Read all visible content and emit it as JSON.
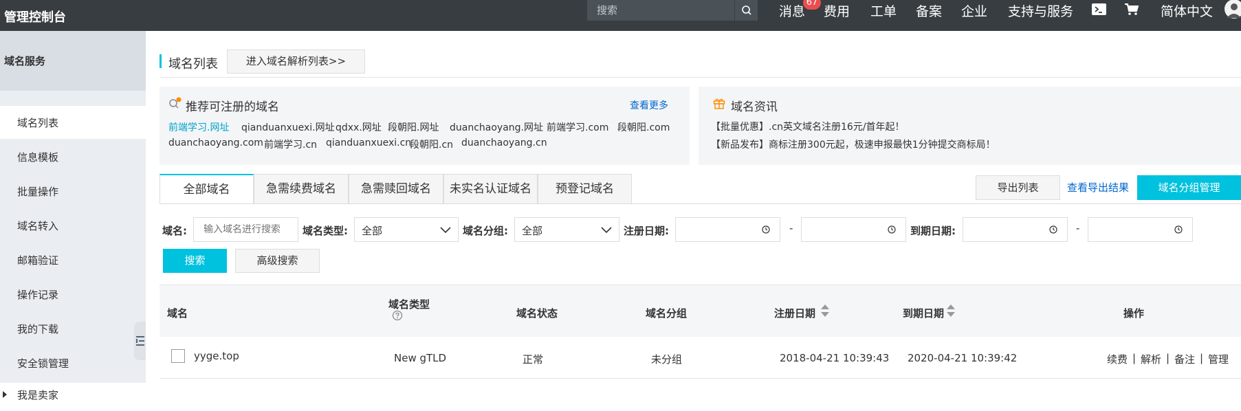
{
  "topbar": {
    "title": "管理控制台",
    "search_placeholder": "搜索",
    "nav": [
      "消息",
      "费用",
      "工单",
      "备案",
      "企业",
      "支持与服务",
      "简体中文"
    ],
    "message_badge": "67"
  },
  "sidebar": {
    "header": "域名服务",
    "items": [
      "域名列表",
      "信息模板",
      "批量操作",
      "域名转入",
      "邮箱验证",
      "操作记录",
      "我的下载",
      "安全锁管理",
      "我是卖家"
    ],
    "active_index": 0
  },
  "page": {
    "title": "域名列表",
    "dns_button": "进入域名解析列表>>"
  },
  "recommend": {
    "title": "推荐可注册的域名",
    "more": "查看更多",
    "domains": [
      "前端学习.网址",
      "qianduanxuexi.网址",
      "qdxx.网址",
      "段朝阳.网址",
      "duanchaoyang.网址",
      "前端学习.com",
      "段朝阳.com",
      "duanchaoyang.com",
      "前端学习.cn",
      "qianduanxuexi.cn",
      "段朝阳.cn",
      "duanchaoyang.cn"
    ]
  },
  "news": {
    "title": "域名资讯",
    "items": [
      "【批量优惠】.cn英文域名注册16元/首年起！",
      "【新品发布】商标注册300元起，极速申报最快1分钟提交商标局！"
    ]
  },
  "tabs": [
    "全部域名",
    "急需续费域名",
    "急需赎回域名",
    "未实名认证域名",
    "预登记域名"
  ],
  "actions": {
    "export": "导出列表",
    "view_export": "查看导出结果",
    "group_manage": "域名分组管理"
  },
  "filters": {
    "domain_label": "域名:",
    "domain_placeholder": "输入域名进行搜索",
    "type_label": "域名类型:",
    "type_value": "全部",
    "group_label": "域名分组:",
    "group_value": "全部",
    "reg_label": "注册日期:",
    "exp_label": "到期日期:",
    "dash": "-",
    "search": "搜索",
    "advanced": "高级搜索"
  },
  "table": {
    "headers": [
      "域名",
      "域名类型",
      "域名状态",
      "域名分组",
      "注册日期",
      "到期日期",
      "操作"
    ],
    "rows": [
      {
        "domain": "yyge.top",
        "type": "New gTLD",
        "status": "正常",
        "group": "未分组",
        "reg": "2018-04-21 10:39:43",
        "exp": "2020-04-21 10:39:42",
        "ops": [
          "续费",
          "解析",
          "备注",
          "管理"
        ]
      }
    ]
  },
  "colors": {
    "topbar": "#373d41",
    "accent": "#00c1de",
    "link": "#0066cc",
    "badge": "#e94e4e"
  }
}
